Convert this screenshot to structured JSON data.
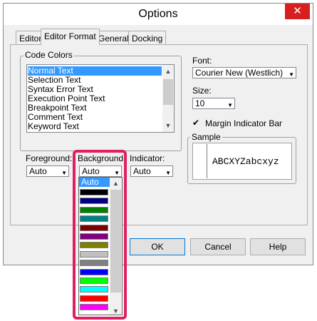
{
  "window": {
    "title": "Options",
    "close_glyph": "✕"
  },
  "tabs": [
    {
      "label": "Editor",
      "active": false
    },
    {
      "label": "Editor Format",
      "active": true
    },
    {
      "label": "General",
      "active": false
    },
    {
      "label": "Docking",
      "active": false
    }
  ],
  "code_colors": {
    "group_label": "Code Colors",
    "items": [
      "Normal Text",
      "Selection Text",
      "Syntax Error Text",
      "Execution Point Text",
      "Breakpoint Text",
      "Comment Text",
      "Keyword Text"
    ],
    "selected_index": 0
  },
  "foreground": {
    "label": "Foreground:",
    "value": "Auto"
  },
  "background": {
    "label": "Background:",
    "value": "Auto"
  },
  "indicator": {
    "label": "Indicator:",
    "value": "Auto"
  },
  "font": {
    "label": "Font:",
    "value": "Courier New (Westlich)"
  },
  "size": {
    "label": "Size:",
    "value": "10"
  },
  "margin_indicator": {
    "label": "Margin Indicator Bar",
    "checked": true
  },
  "sample": {
    "label": "Sample",
    "text": "ABCXYZabcxyz"
  },
  "buttons": {
    "ok": "OK",
    "cancel": "Cancel",
    "help": "Help"
  },
  "color_dropdown": {
    "selected": "Auto",
    "swatches": [
      "#000000",
      "#000080",
      "#008000",
      "#008080",
      "#800000",
      "#800080",
      "#808000",
      "#c0c0c0",
      "#808080",
      "#0000ff",
      "#00ff00",
      "#00ffff",
      "#ff0000",
      "#ff00ff"
    ]
  },
  "highlight_color": "#e01e63"
}
